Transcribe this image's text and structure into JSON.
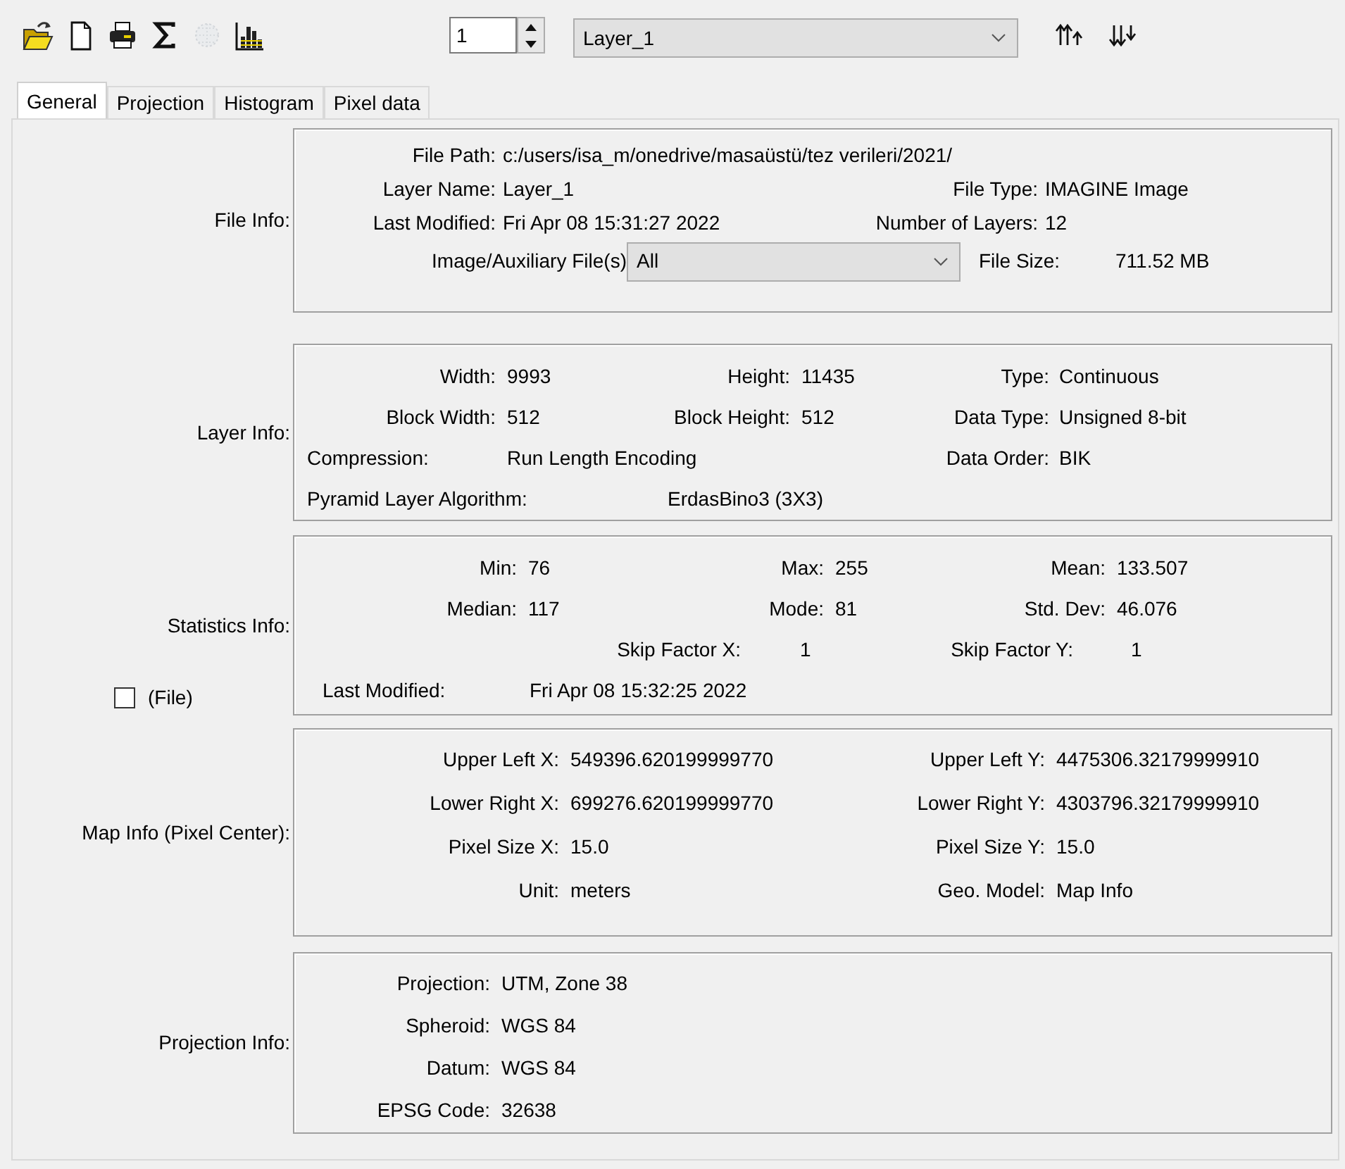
{
  "toolbar": {
    "buttons": [
      {
        "disabled": false
      },
      {
        "disabled": false
      },
      {
        "disabled": false
      },
      {
        "disabled": false
      },
      {
        "disabled": true
      },
      {
        "disabled": false
      }
    ],
    "layer_number": "1",
    "layer": "Layer_1"
  },
  "tabs": [
    {
      "label": "General",
      "selected": true
    },
    {
      "label": "Projection",
      "selected": false
    },
    {
      "label": "Histogram",
      "selected": false
    },
    {
      "label": "Pixel data",
      "selected": false
    }
  ],
  "sections": [
    {
      "label": "File Info:",
      "rows": [
        [
          {
            "kind": "pair",
            "label": "File Path:",
            "value": "c:/users/isa_m/onedrive/masaüstü/tez verileri/2021/"
          }
        ],
        [
          {
            "kind": "pair",
            "label": "Layer Name:",
            "value": "Layer_1"
          },
          {
            "kind": "pair",
            "label": "File Type:",
            "value": "IMAGINE Image"
          }
        ],
        [
          {
            "kind": "pair",
            "label": "Last Modified:",
            "value": "Fri Apr 08 15:31:27 2022"
          },
          {
            "kind": "pair",
            "label": "Number of Layers:",
            "value": "12"
          }
        ],
        [
          {
            "kind": "select",
            "label": "Image/Auxiliary File(s)",
            "value": "All"
          },
          {
            "kind": "pair",
            "label": "File Size:",
            "value": "711.52 MB"
          }
        ]
      ]
    },
    {
      "label": "Layer Info:",
      "rows": [
        [
          {
            "kind": "pair",
            "label": "Width:",
            "value": "9993"
          },
          {
            "kind": "pair",
            "label": "Height:",
            "value": "11435"
          },
          {
            "kind": "pair",
            "label": "Type:",
            "value": "Continuous"
          }
        ],
        [
          {
            "kind": "pair",
            "label": "Block Width:",
            "value": "512"
          },
          {
            "kind": "pair",
            "label": "Block Height:",
            "value": "512"
          },
          {
            "kind": "pair",
            "label": "Data Type:",
            "value": "Unsigned 8-bit"
          }
        ],
        [
          {
            "kind": "pair",
            "label": "Compression:",
            "value": "Run Length Encoding"
          },
          {
            "kind": "blank"
          },
          {
            "kind": "pair",
            "label": "Data Order:",
            "value": "BIK"
          }
        ],
        [
          {
            "kind": "pair",
            "label": "Pyramid Layer Algorithm:",
            "value": "ErdasBino3 (3X3)"
          }
        ]
      ]
    },
    {
      "label": "Statistics Info:",
      "checkbox": {
        "label": "(File)",
        "checked": false
      },
      "rows": [
        [
          {
            "kind": "pair",
            "label": "Min:",
            "value": "76"
          },
          {
            "kind": "pair",
            "label": "Max:",
            "value": "255"
          },
          {
            "kind": "pair",
            "label": "Mean:",
            "value": "133.507"
          }
        ],
        [
          {
            "kind": "pair",
            "label": "Median:",
            "value": "117"
          },
          {
            "kind": "pair",
            "label": "Mode:",
            "value": "81"
          },
          {
            "kind": "pair",
            "label": "Std. Dev:",
            "value": "46.076"
          }
        ],
        [
          {
            "kind": "blank"
          },
          {
            "kind": "pair",
            "label": "Skip Factor X:",
            "value": "1"
          },
          {
            "kind": "pair",
            "label": "Skip Factor Y:",
            "value": "1"
          }
        ],
        [
          {
            "kind": "pair",
            "label": "Last Modified:",
            "value": "Fri Apr 08 15:32:25 2022"
          }
        ]
      ]
    },
    {
      "label": "Map Info (Pixel Center):",
      "rows": [
        [
          {
            "kind": "pair",
            "label": "Upper Left X:",
            "value": "549396.620199999770"
          },
          {
            "kind": "pair",
            "label": "Upper Left Y:",
            "value": "4475306.32179999910"
          }
        ],
        [
          {
            "kind": "pair",
            "label": "Lower Right X:",
            "value": "699276.620199999770"
          },
          {
            "kind": "pair",
            "label": "Lower Right Y:",
            "value": "4303796.32179999910"
          }
        ],
        [
          {
            "kind": "pair",
            "label": "Pixel Size X:",
            "value": "15.0"
          },
          {
            "kind": "pair",
            "label": "Pixel Size Y:",
            "value": "15.0"
          }
        ],
        [
          {
            "kind": "pair",
            "label": "Unit:",
            "value": "meters"
          },
          {
            "kind": "pair",
            "label": "Geo. Model:",
            "value": "Map Info"
          }
        ]
      ]
    },
    {
      "label": "Projection Info:",
      "rows": [
        [
          {
            "kind": "pair",
            "label": "Projection:",
            "value": "UTM, Zone 38"
          }
        ],
        [
          {
            "kind": "pair",
            "label": "Spheroid:",
            "value": "WGS 84"
          }
        ],
        [
          {
            "kind": "pair",
            "label": "Datum:",
            "value": "WGS 84"
          }
        ],
        [
          {
            "kind": "pair",
            "label": "EPSG Code:",
            "value": "32638"
          }
        ]
      ]
    }
  ]
}
